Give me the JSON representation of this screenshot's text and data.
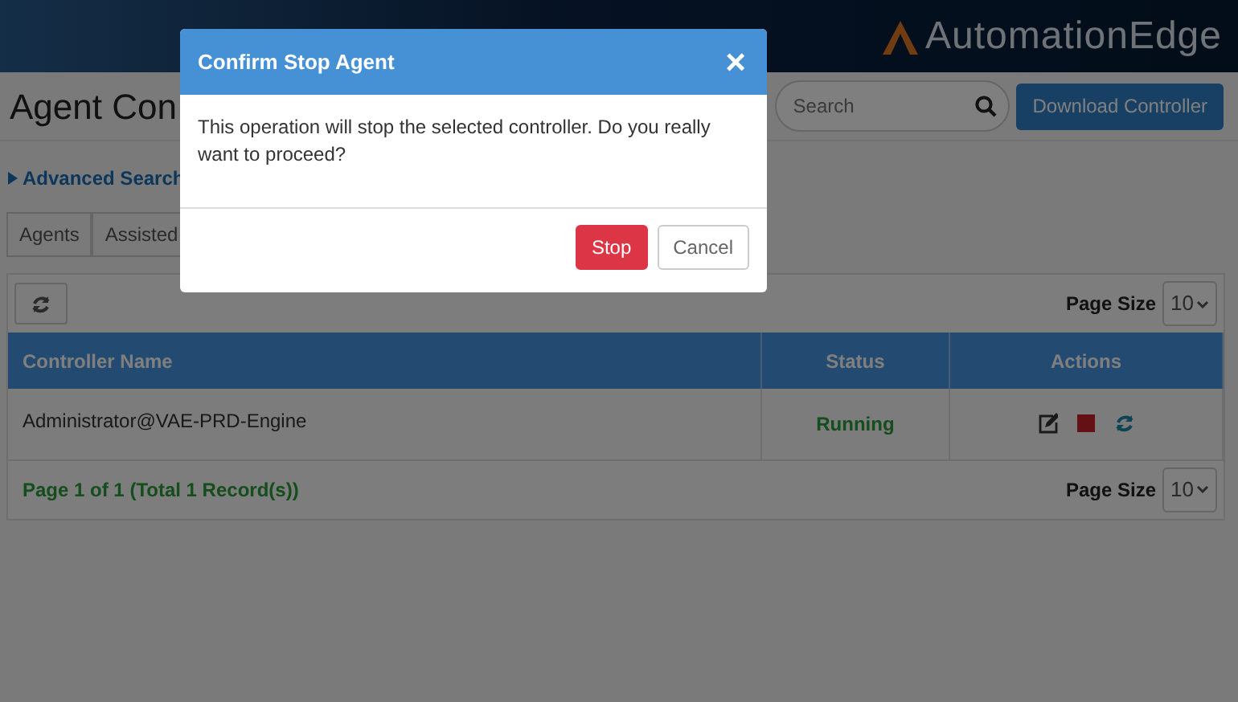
{
  "header": {
    "logo": "AutomationEdge"
  },
  "page": {
    "title": "Agent Con",
    "search": {
      "placeholder": "Search"
    },
    "download_button": "Download Controller",
    "advanced_search": {
      "label": "Advanced Search",
      "expanded": false
    },
    "tabs": [
      {
        "label": "Agents"
      },
      {
        "label": "Assisted"
      }
    ]
  },
  "table": {
    "page_size_label": "Page Size",
    "page_size": "10",
    "columns": [
      "Controller Name",
      "Status",
      "Actions"
    ],
    "rows": [
      {
        "name": "Administrator@VAE-PRD-Engine",
        "status": "Running"
      }
    ],
    "footer": "Page 1 of 1 (Total 1 Record(s))",
    "footer_page_size_label": "Page Size",
    "footer_page_size": "10"
  },
  "modal": {
    "title": "Confirm Stop Agent",
    "close": "×",
    "message": "This operation will stop the selected controller. Do you really want to proceed?",
    "buttons": [
      {
        "label": "Stop",
        "kind": "danger"
      },
      {
        "label": "Cancel",
        "kind": "default"
      }
    ]
  }
}
